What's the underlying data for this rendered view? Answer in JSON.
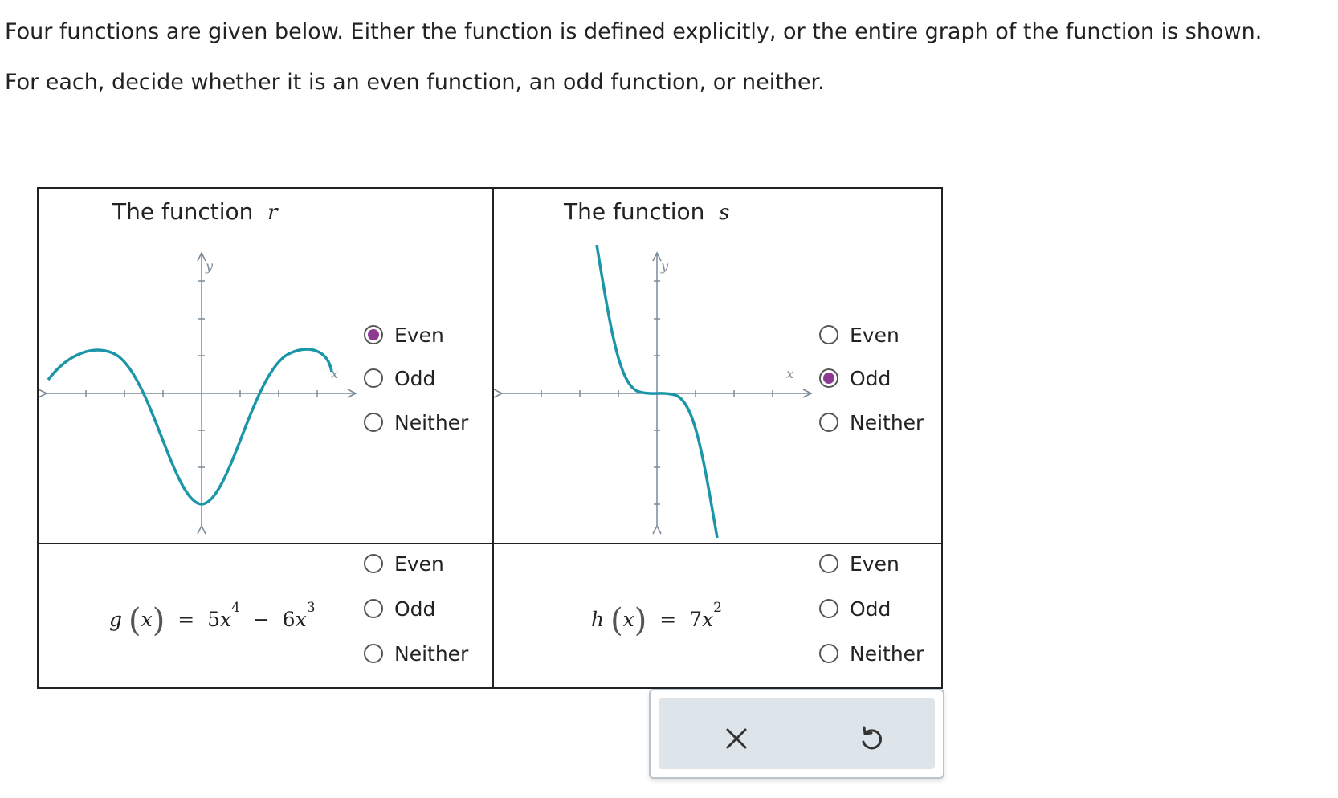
{
  "prompt": {
    "line1": "Four functions are given below. Either the function is defined explicitly, or the entire graph of the function is shown.",
    "line2": "For each, decide whether it is an even function, an odd function, or neither."
  },
  "cells": {
    "r": {
      "title_prefix": "The function",
      "var": "r",
      "graph": {
        "x_label": "x",
        "y_label": "y",
        "curve_color": "#1b95a8"
      },
      "options": [
        "Even",
        "Odd",
        "Neither"
      ],
      "selected": "Even"
    },
    "s": {
      "title_prefix": "The function",
      "var": "s",
      "graph": {
        "x_label": "x",
        "y_label": "y",
        "curve_color": "#1b95a8"
      },
      "options": [
        "Even",
        "Odd",
        "Neither"
      ],
      "selected": "Odd"
    },
    "g": {
      "fn": "g",
      "arg": "x",
      "eq": "=",
      "term1_coef": "5",
      "term1_var": "x",
      "term1_exp": "4",
      "op": "−",
      "term2_coef": "6",
      "term2_var": "x",
      "term2_exp": "3",
      "options": [
        "Even",
        "Odd",
        "Neither"
      ],
      "selected": ""
    },
    "h": {
      "fn": "h",
      "arg": "x",
      "eq": "=",
      "term1_coef": "7",
      "term1_var": "x",
      "term1_exp": "2",
      "options": [
        "Even",
        "Odd",
        "Neither"
      ],
      "selected": ""
    }
  },
  "toolbar": {
    "clear_icon": "close-icon",
    "reset_icon": "undo-icon"
  },
  "colors": {
    "accent": "#8e3a93",
    "curve": "#1b95a8",
    "axis": "#7a8a99",
    "toolbar_bg": "#dde4ea"
  }
}
